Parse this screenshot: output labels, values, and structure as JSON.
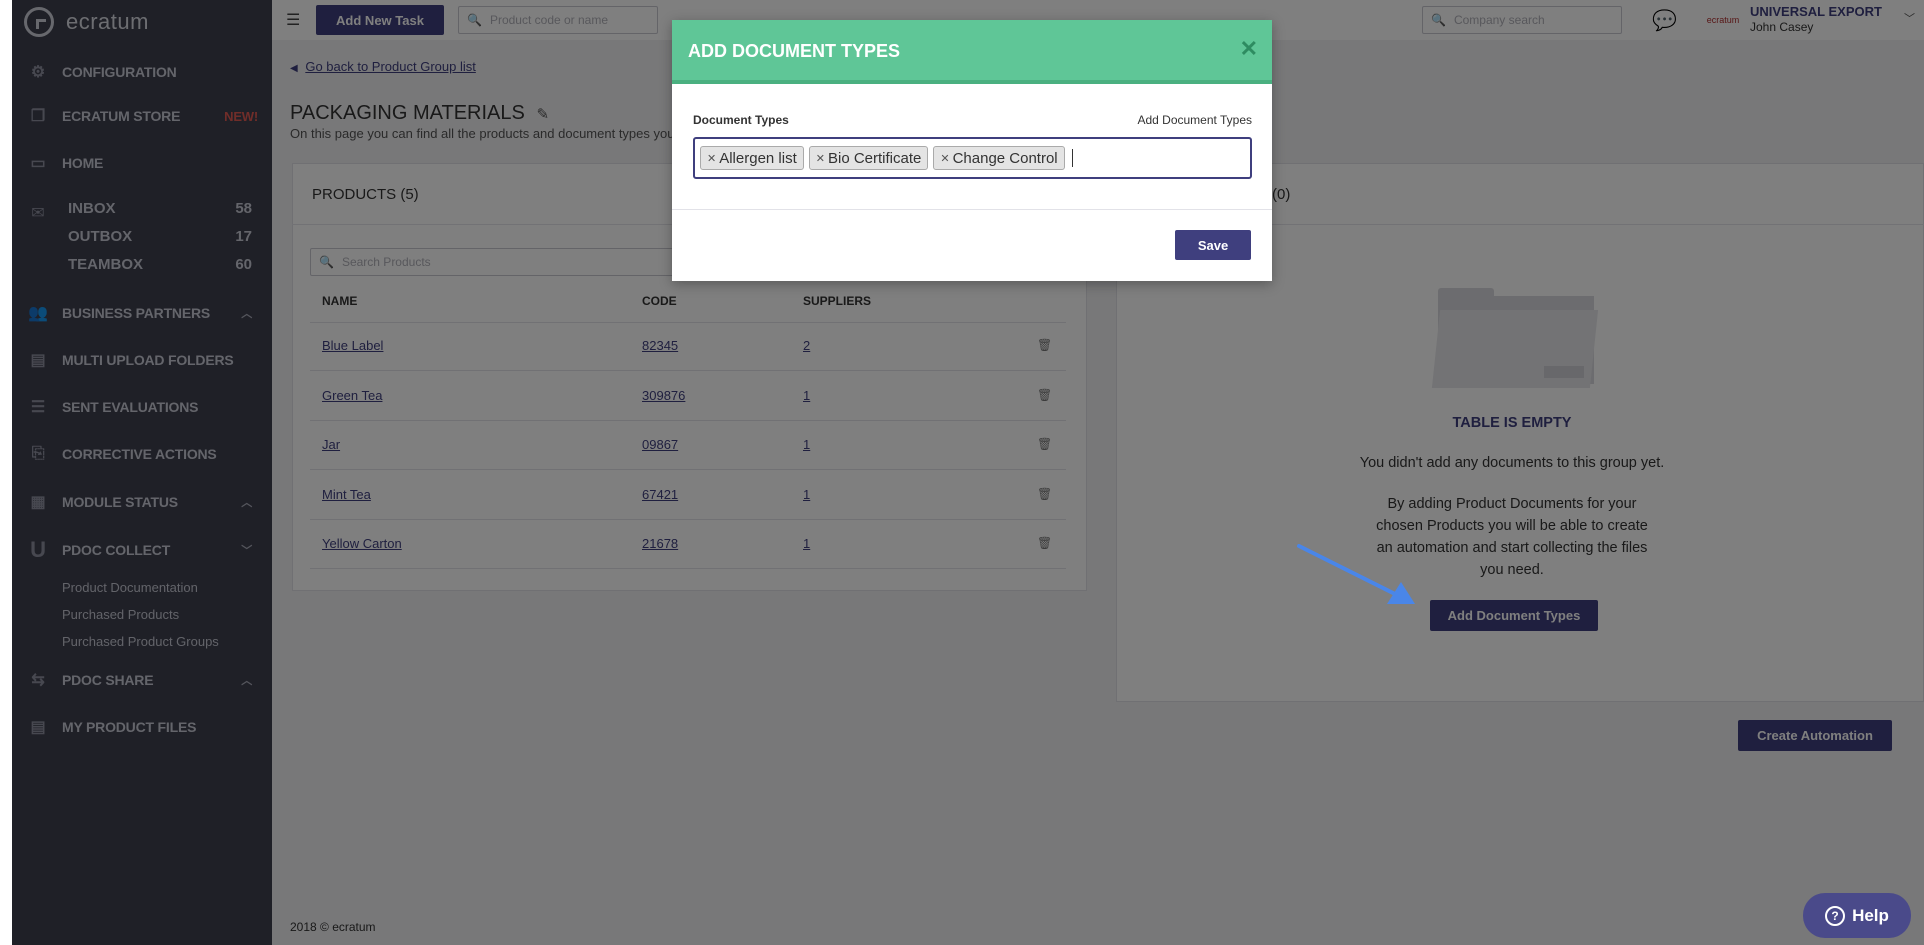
{
  "sidebar": {
    "logo_text": "ecratum",
    "items": {
      "configuration": "CONFIGURATION",
      "store": "ECRATUM STORE",
      "store_badge": "NEW!",
      "home": "HOME",
      "inbox": "INBOX",
      "inbox_count": "58",
      "outbox": "OUTBOX",
      "outbox_count": "17",
      "teambox": "TEAMBOX",
      "teambox_count": "60",
      "business_partners": "BUSINESS PARTNERS",
      "multi_upload": "MULTI UPLOAD FOLDERS",
      "sent_evaluations": "SENT EVALUATIONS",
      "corrective_actions": "CORRECTIVE ACTIONS",
      "module_status": "MODULE STATUS",
      "pdoc_collect": "PDOC COLLECT",
      "product_documentation": "Product Documentation",
      "purchased_products": "Purchased Products",
      "purchased_product_groups": "Purchased Product Groups",
      "pdoc_share": "PDOC SHARE",
      "my_product_files": "MY PRODUCT FILES"
    }
  },
  "topbar": {
    "add_task": "Add New Task",
    "product_search_placeholder": "Product code or name",
    "company_search_placeholder": "Company search",
    "company_name": "UNIVERSAL EXPORT",
    "user_name": "John Casey",
    "avatar_text": "ecratum"
  },
  "page": {
    "back_link": "Go back to Product Group list",
    "title": "PACKAGING MATERIALS",
    "subtitle": "On this page you can find all the products and document types you h",
    "footer": "2018 © ecratum"
  },
  "products": {
    "heading": "PRODUCTS (5)",
    "search_placeholder": "Search Products",
    "columns": [
      "NAME",
      "CODE",
      "SUPPLIERS"
    ],
    "rows": [
      {
        "name": "Blue Label",
        "code": "82345",
        "suppliers": "2"
      },
      {
        "name": "Green Tea",
        "code": "309876",
        "suppliers": "1"
      },
      {
        "name": "Jar",
        "code": "09867",
        "suppliers": "1"
      },
      {
        "name": "Mint Tea",
        "code": "67421",
        "suppliers": "1"
      },
      {
        "name": "Yellow Carton",
        "code": "21678",
        "suppliers": "1"
      }
    ]
  },
  "documents": {
    "heading_suffix": "(0)",
    "empty_title": "TABLE IS EMPTY",
    "empty_line1": "You didn't add any documents to this group yet.",
    "empty_line2": "By adding Product Documents for your chosen Products you will be able to create an automation and start collecting the files you need.",
    "add_button": "Add Document Types",
    "create_automation": "Create Automation"
  },
  "modal": {
    "title": "ADD DOCUMENT TYPES",
    "field_label": "Document Types",
    "link": "Add Document Types",
    "tags": [
      "Allergen list",
      "Bio Certificate",
      "Change Control"
    ],
    "save": "Save"
  },
  "help": {
    "label": "Help"
  },
  "colors": {
    "accent": "#3f3f7e",
    "modal_header": "#5fc697",
    "sidebar": "#3f414f",
    "new_badge": "#e15a52",
    "arrow": "#4a86e8"
  }
}
